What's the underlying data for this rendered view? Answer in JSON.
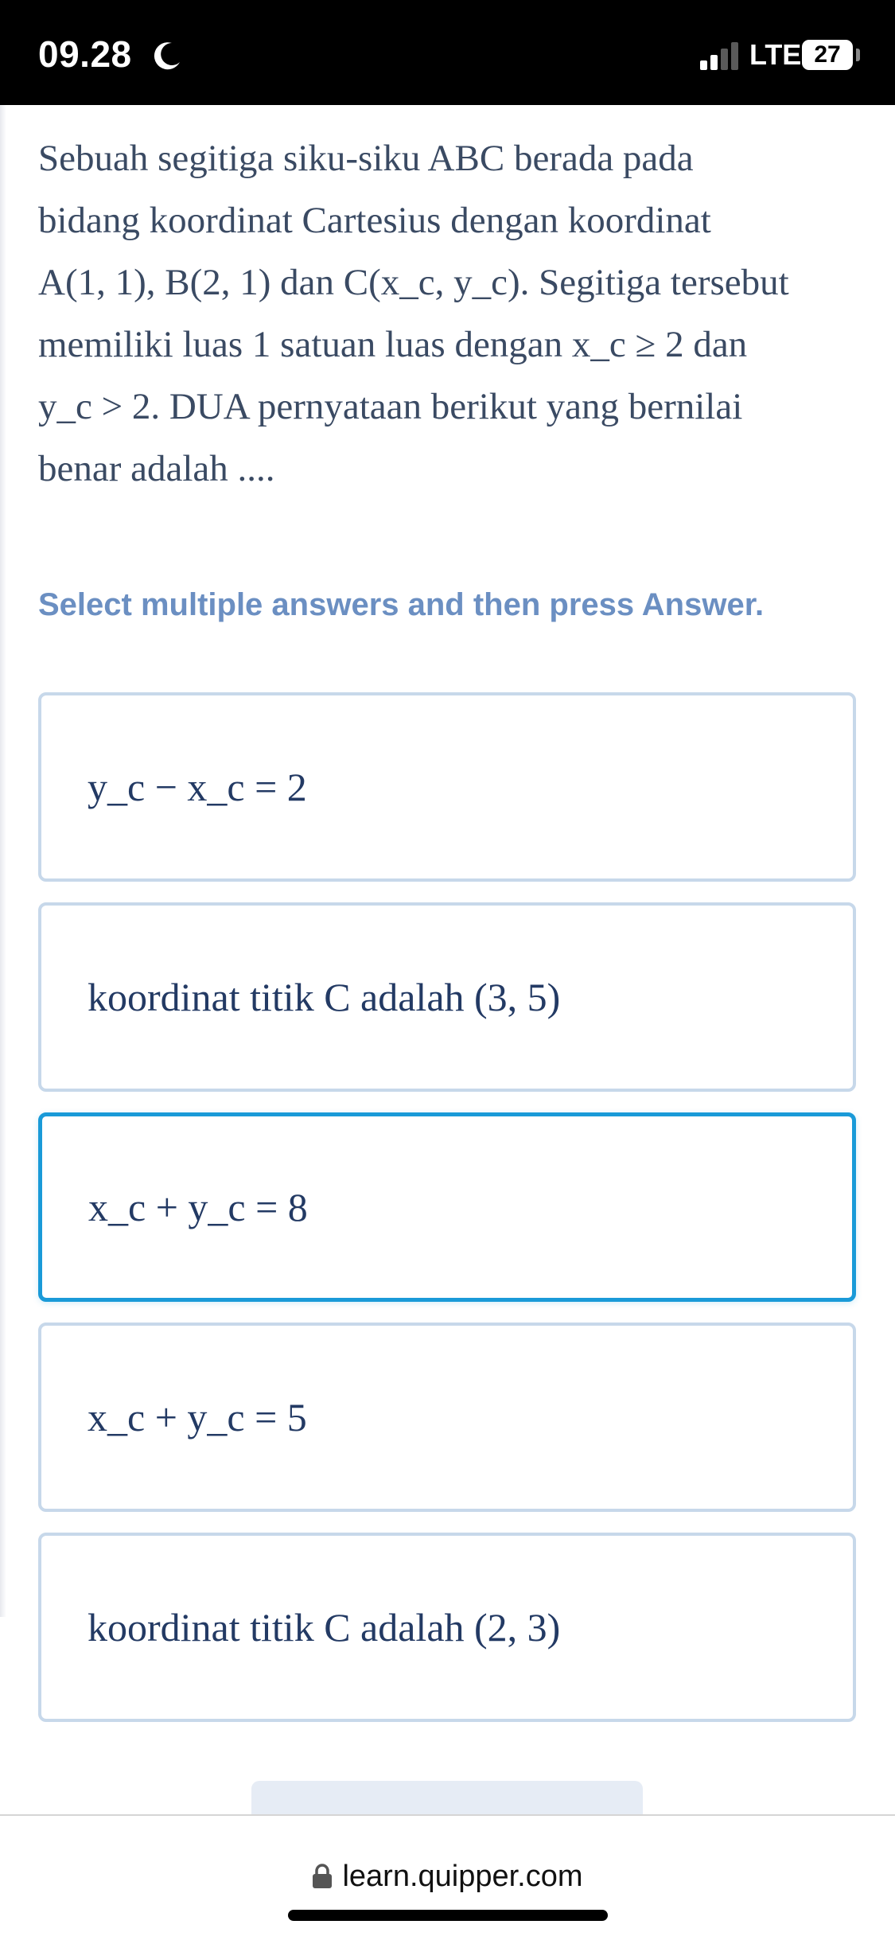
{
  "status_bar": {
    "time": "09.28",
    "network": "LTE",
    "battery": "27"
  },
  "question": {
    "line1": "Sebuah segitiga siku-siku ABC berada pada",
    "line2": "bidang koordinat Cartesius dengan koordinat",
    "line3": "A(1, 1), B(2, 1) dan C(x_c, y_c). Segitiga tersebut",
    "line4": "memiliki luas 1 satuan luas dengan x_c ≥ 2 dan",
    "line5": "y_c > 2. DUA pernyataan berikut yang bernilai",
    "line6": "benar adalah ...."
  },
  "instruction": "Select multiple answers and then press Answer.",
  "options": [
    {
      "text": "y_c − x_c = 2",
      "selected": false
    },
    {
      "text": "koordinat titik C adalah (3, 5)",
      "selected": false
    },
    {
      "text": "x_c + y_c = 8",
      "selected": true
    },
    {
      "text": "x_c + y_c = 5",
      "selected": false
    },
    {
      "text": "koordinat titik C adalah (2, 3)",
      "selected": false
    }
  ],
  "browser": {
    "url": "learn.quipper.com"
  },
  "icons": {
    "moon": "moon-icon",
    "signal": "signal-icon",
    "lock": "lock-icon"
  },
  "colors": {
    "text": "#3a4a63",
    "option_text": "#233a64",
    "instruction": "#6b8fc2",
    "option_border": "#c7d8ea",
    "selected_border": "#1a9ad8"
  }
}
